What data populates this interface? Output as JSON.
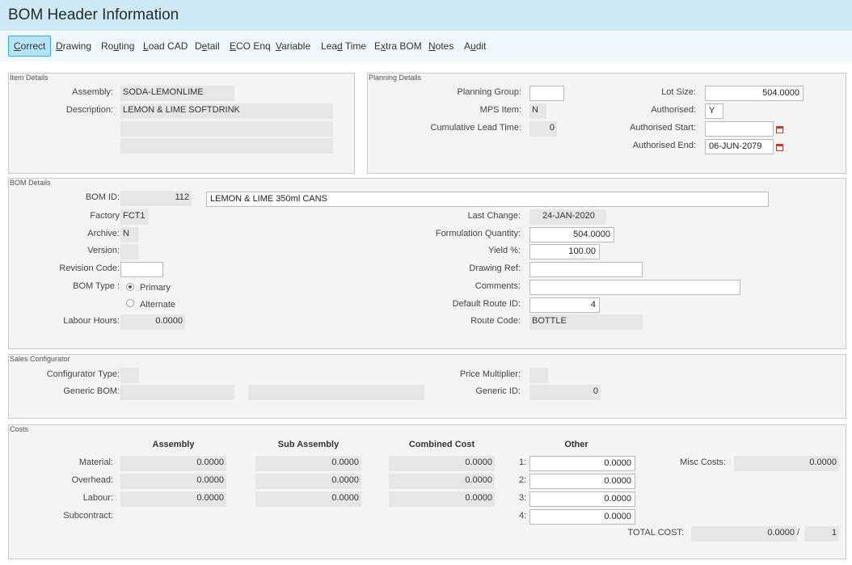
{
  "window": {
    "title": "BOM Header Information"
  },
  "toolbar": {
    "items": [
      {
        "pre": "",
        "u": "C",
        "post": "orrect"
      },
      {
        "pre": "",
        "u": "D",
        "post": "rawing"
      },
      {
        "pre": "Ro",
        "u": "u",
        "post": "ting"
      },
      {
        "pre": "",
        "u": "L",
        "post": "oad CAD"
      },
      {
        "pre": "D",
        "u": "e",
        "post": "tail"
      },
      {
        "pre": "",
        "u": "E",
        "post": "CO Enq"
      },
      {
        "pre": "",
        "u": "V",
        "post": "ariable"
      },
      {
        "pre": "Lea",
        "u": "d",
        "post": " Time"
      },
      {
        "pre": "E",
        "u": "x",
        "post": "tra BOM"
      },
      {
        "pre": "",
        "u": "N",
        "post": "otes"
      },
      {
        "pre": "A",
        "u": "u",
        "post": "dit"
      }
    ]
  },
  "item_details": {
    "title": "Item Details",
    "assembly_label": "Assembly:",
    "assembly": "SODA-LEMONLIME",
    "description_label": "Description:",
    "description": [
      "LEMON & LIME SOFTDRINK",
      "",
      ""
    ]
  },
  "planning_details": {
    "title": "Planning Details",
    "planning_group_label": "Planning Group:",
    "planning_group": "",
    "mps_item_label": "MPS Item:",
    "mps_item": "N",
    "cum_lead_label": "Cumulative Lead Time:",
    "cum_lead": "0",
    "lot_size_label": "Lot Size:",
    "lot_size": "504.0000",
    "authorised_label": "Authorised:",
    "authorised": "Y",
    "auth_start_label": "Authorised Start:",
    "auth_start": "",
    "auth_end_label": "Authorised End:",
    "auth_end": "06-JUN-2079"
  },
  "bom_details": {
    "title": "BOM Details",
    "bom_id_label": "BOM ID:",
    "bom_id": "112",
    "bom_desc": "LEMON & LIME 350ml CANS",
    "factory_label": "Factory",
    "factory": "FCT1",
    "archive_label": "Archive:",
    "archive": "N",
    "version_label": "Version:",
    "version": "",
    "revision_label": "Revision Code:",
    "revision": "",
    "bom_type_label": "BOM Type :",
    "type_primary": "Primary",
    "type_alternate": "Alternate",
    "labour_label": "Labour Hours:",
    "labour": "0.0000",
    "last_change_label": "Last Change:",
    "last_change": "24-JAN-2020",
    "form_qty_label": "Formulation Quantity:",
    "form_qty": "504.0000",
    "yield_label": "Yield %:",
    "yield": "100.00",
    "drawing_label": "Drawing Ref:",
    "drawing": "",
    "comments_label": "Comments:",
    "comments": "",
    "route_id_label": "Default Route ID:",
    "route_id": "4",
    "route_code_label": "Route Code:",
    "route_code": "BOTTLE"
  },
  "sales_config": {
    "title": "Sales Configurator",
    "config_type_label": "Configurator Type:",
    "config_type": "",
    "generic_bom_label": "Generic BOM:",
    "generic_bom_1": "",
    "generic_bom_2": "",
    "price_mult_label": "Price Multiplier:",
    "price_mult": "",
    "generic_id_label": "Generic ID:",
    "generic_id": "0"
  },
  "costs": {
    "title": "Costs",
    "col_assembly": "Assembly",
    "col_sub": "Sub Assembly",
    "col_combined": "Combined Cost",
    "col_other": "Other",
    "rows": [
      {
        "label": "Material:",
        "assembly": "0.0000",
        "sub": "0.0000",
        "combined": "0.0000"
      },
      {
        "label": "Overhead:",
        "assembly": "0.0000",
        "sub": "0.0000",
        "combined": "0.0000"
      },
      {
        "label": "Labour:",
        "assembly": "0.0000",
        "sub": "0.0000",
        "combined": "0.0000"
      },
      {
        "label": "Subcontract:"
      }
    ],
    "other": [
      {
        "n": "1:",
        "v": "0.0000"
      },
      {
        "n": "2:",
        "v": "0.0000"
      },
      {
        "n": "3:",
        "v": "0.0000"
      },
      {
        "n": "4:",
        "v": "0.0000"
      }
    ],
    "misc_label": "Misc Costs:",
    "misc": "0.0000",
    "total_label": "TOTAL COST:",
    "total": "0.0000",
    "total_sep": "/",
    "total_count": "1"
  }
}
